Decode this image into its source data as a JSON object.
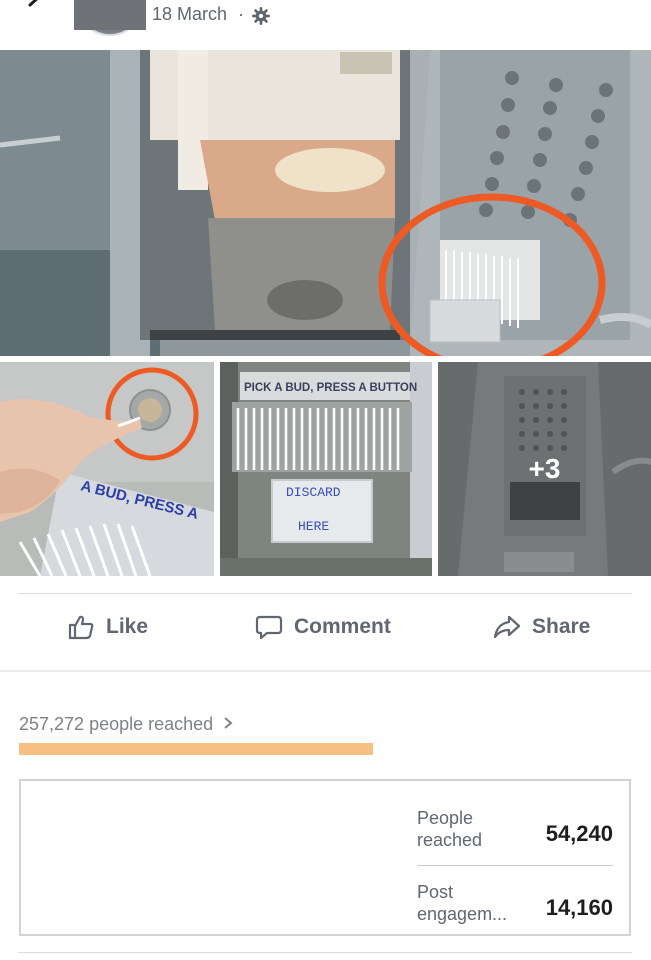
{
  "post": {
    "date": "18 March",
    "separator": "·",
    "settings_icon": "gear-icon"
  },
  "photos": {
    "more_count": "+3",
    "sign_pick": "PICK A BUD, PRESS A BUTTON",
    "sign_bud": "A BUD, PRESS A",
    "sign_discard": "DISCARD",
    "sign_here": "HERE"
  },
  "actions": {
    "like": "Like",
    "comment": "Comment",
    "share": "Share"
  },
  "insights": {
    "reach_text": "257,272 people reached",
    "reach_bar_fraction": 1.0,
    "stats": [
      {
        "label": "People reached",
        "value": "54,240"
      },
      {
        "label": "Post engagem...",
        "value": "14,160"
      }
    ]
  },
  "colors": {
    "reach_bar": "#f7bf82",
    "highlight_circle": "#ee5a24"
  }
}
